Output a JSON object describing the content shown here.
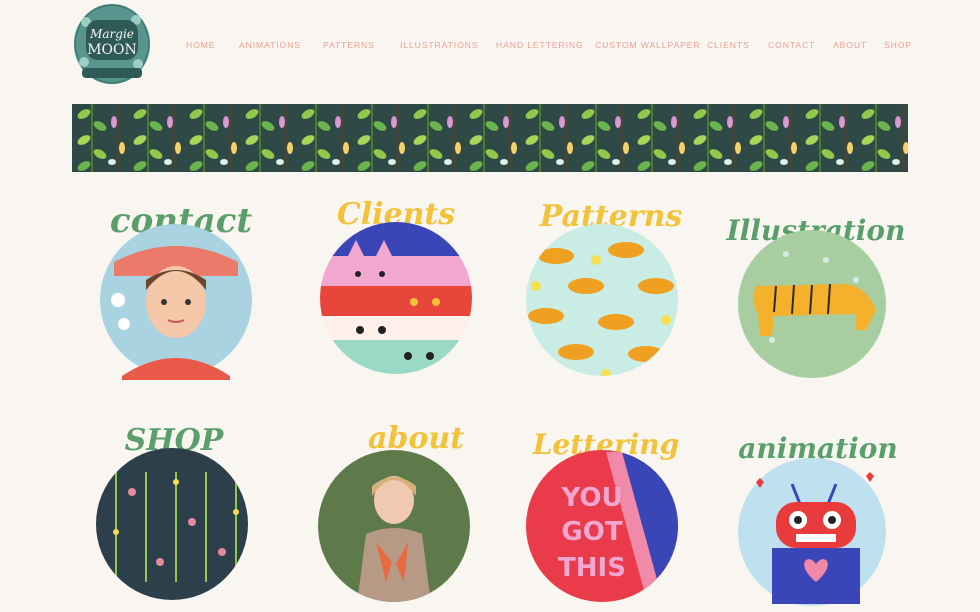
{
  "brand": {
    "line1": "Margie",
    "line2": "MOON",
    "accent": "#2f5a58"
  },
  "nav": {
    "items": [
      {
        "label": "HOME"
      },
      {
        "label": "ANIMATIONS"
      },
      {
        "label": "PATTERNS"
      },
      {
        "label": "ILLUSTRATIONS"
      },
      {
        "label": "HAND LETTERING"
      },
      {
        "label": "CUSTOM WALLPAPER"
      },
      {
        "label": "CLIENTS"
      },
      {
        "label": "CONTACT"
      },
      {
        "label": "ABOUT"
      },
      {
        "label": "SHOP"
      }
    ]
  },
  "tiles": [
    {
      "title": "contact",
      "color": "#5a9f6b"
    },
    {
      "title": "Clients",
      "color": "#f1c23a"
    },
    {
      "title": "Patterns",
      "color": "#f1c23a"
    },
    {
      "title": "Illustration",
      "color": "#5a9f6b"
    },
    {
      "title": "SHOP",
      "color": "#5a9f6b"
    },
    {
      "title": "about",
      "color": "#f1c23a"
    },
    {
      "title": "Lettering",
      "color": "#f1c23a"
    },
    {
      "title": "animation",
      "color": "#5a9f6b"
    }
  ],
  "lettering_art": {
    "line1": "YOU",
    "line2": "GOT",
    "line3": "THIS"
  },
  "colors": {
    "background": "#f9f6f2",
    "nav": "#e9a08f",
    "banner_bg": "#2f4a46",
    "leaf": "#8fc84a"
  }
}
